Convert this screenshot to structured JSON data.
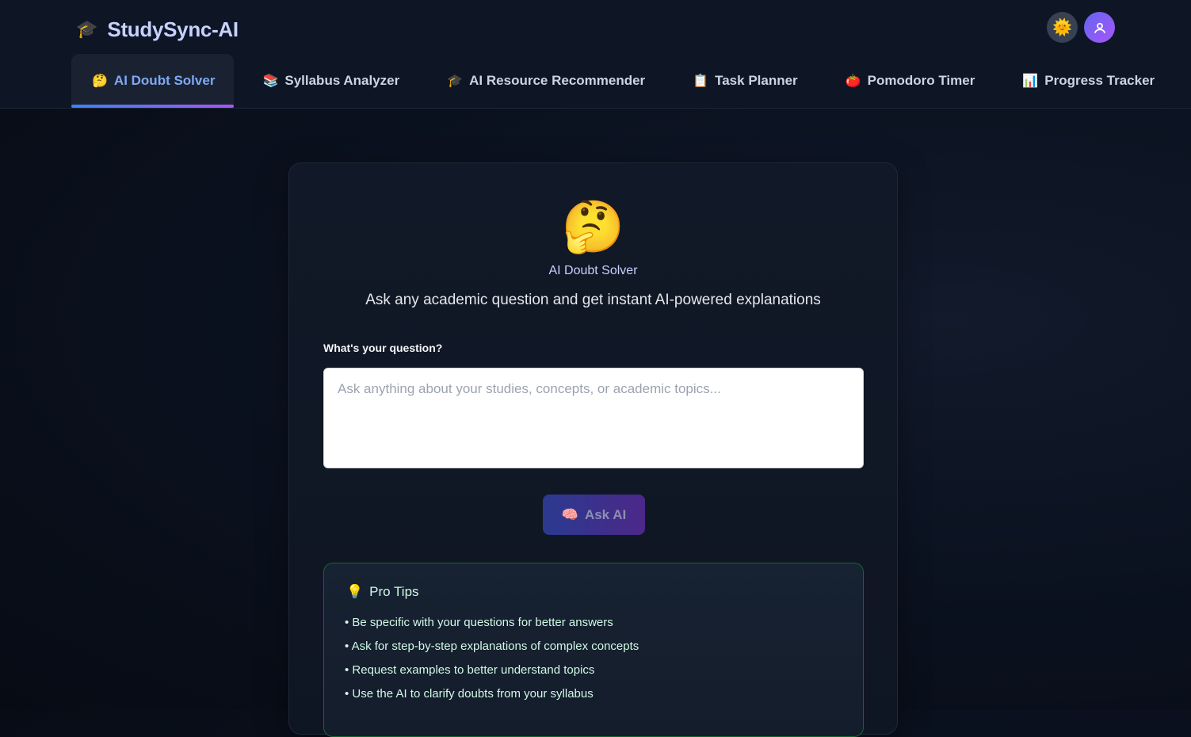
{
  "brand": {
    "icon": "🎓",
    "name": "StudySync-AI"
  },
  "header": {
    "theme_icon": "🌞",
    "avatar_icon": "user-icon"
  },
  "tabs": [
    {
      "icon": "🤔",
      "label": "AI Doubt Solver",
      "active": true
    },
    {
      "icon": "📚",
      "label": "Syllabus Analyzer"
    },
    {
      "icon": "🎓",
      "label": "AI Resource Recommender"
    },
    {
      "icon": "📋",
      "label": "Task Planner"
    },
    {
      "icon": "🍅",
      "label": "Pomodoro Timer"
    },
    {
      "icon": "📊",
      "label": "Progress Tracker"
    }
  ],
  "main": {
    "emoji": "🤔",
    "title": "AI Doubt Solver",
    "subtitle": "Ask any academic question and get instant AI-powered explanations",
    "question_label": "What's your question?",
    "question_placeholder": "Ask anything about your studies, concepts, or academic topics...",
    "question_value": "",
    "ask_icon": "🧠",
    "ask_label": "Ask AI"
  },
  "tips": {
    "icon": "💡",
    "title": "Pro Tips",
    "items": [
      "• Be specific with your questions for better answers",
      "• Ask for step-by-step explanations of complex concepts",
      "• Request examples to better understand topics",
      "• Use the AI to clarify doubts from your syllabus"
    ]
  },
  "colors": {
    "background": "#0b1220",
    "accent_blue": "#3b82f6",
    "accent_purple": "#a855f7",
    "active_tab_text": "#7fa9f5",
    "tips_border": "#166534"
  }
}
